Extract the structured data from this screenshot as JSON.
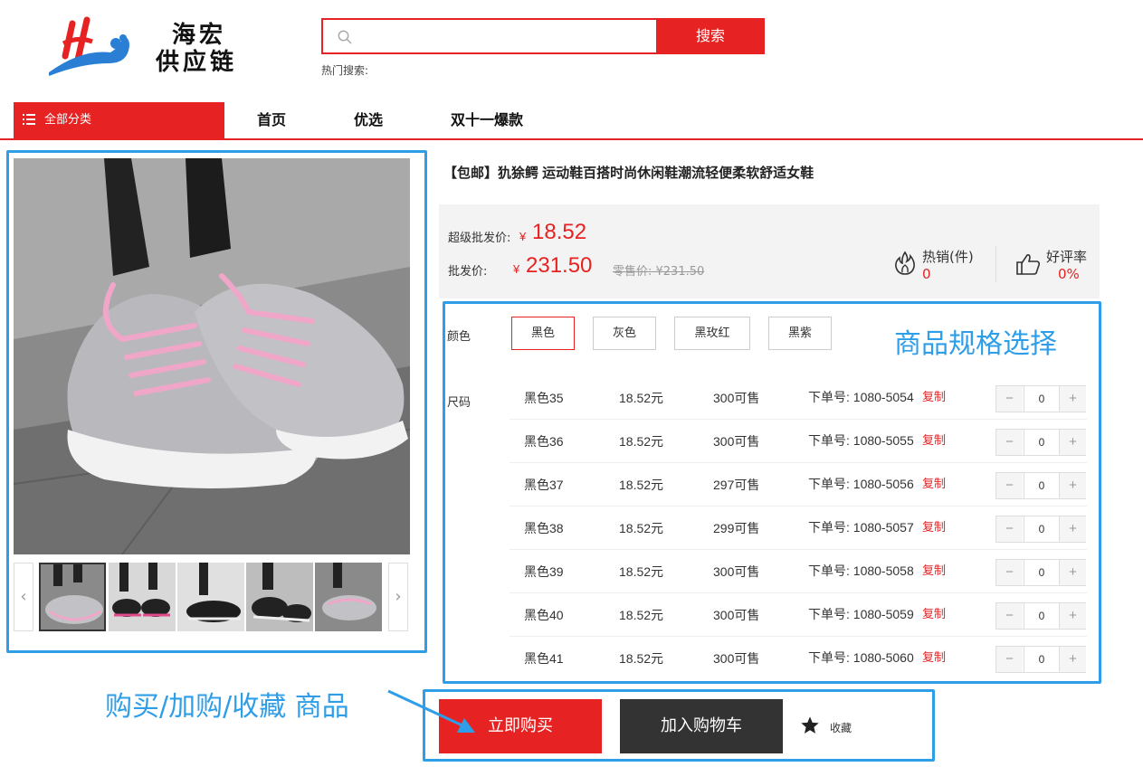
{
  "header": {
    "logo_line1": "海宏",
    "logo_line2": "供应链",
    "search_placeholder": "",
    "search_button": "搜索",
    "hot_search_label": "热门搜索:"
  },
  "nav": {
    "category_label": "全部分类",
    "items": [
      "首页",
      "优选",
      "双十一爆款"
    ]
  },
  "product": {
    "title": "【包邮】犰狳鳄 运动鞋百搭时尚休闲鞋潮流轻便柔软舒适女鞋",
    "super_wholesale_label": "超级批发价:",
    "super_wholesale_price": "18.52",
    "wholesale_label": "批发价:",
    "wholesale_price": "231.50",
    "currency": "¥",
    "retail_text": "零售价: ¥231.50",
    "hot_sales_label": "热销(件)",
    "hot_sales_value": "0",
    "rating_label": "好评率",
    "rating_value": "0%"
  },
  "spec": {
    "color_label": "颜色",
    "size_label": "尺码",
    "colors": [
      "黑色",
      "灰色",
      "黑玫红",
      "黑紫"
    ],
    "selected_color": "黑色",
    "section_annotation": "商品规格选择",
    "rows": [
      {
        "name": "黑色35",
        "price": "18.52元",
        "stock": "300可售",
        "order_no": "下单号: 1080-5054",
        "copy": "复制",
        "qty": "0"
      },
      {
        "name": "黑色36",
        "price": "18.52元",
        "stock": "300可售",
        "order_no": "下单号: 1080-5055",
        "copy": "复制",
        "qty": "0"
      },
      {
        "name": "黑色37",
        "price": "18.52元",
        "stock": "297可售",
        "order_no": "下单号: 1080-5056",
        "copy": "复制",
        "qty": "0"
      },
      {
        "name": "黑色38",
        "price": "18.52元",
        "stock": "299可售",
        "order_no": "下单号: 1080-5057",
        "copy": "复制",
        "qty": "0"
      },
      {
        "name": "黑色39",
        "price": "18.52元",
        "stock": "300可售",
        "order_no": "下单号: 1080-5058",
        "copy": "复制",
        "qty": "0"
      },
      {
        "name": "黑色40",
        "price": "18.52元",
        "stock": "300可售",
        "order_no": "下单号: 1080-5059",
        "copy": "复制",
        "qty": "0"
      },
      {
        "name": "黑色41",
        "price": "18.52元",
        "stock": "300可售",
        "order_no": "下单号: 1080-5060",
        "copy": "复制",
        "qty": "0"
      }
    ]
  },
  "actions": {
    "buy_now": "立即购买",
    "add_to_cart": "加入购物车",
    "favorite": "收藏",
    "annotation": "购买/加购/收藏  商品"
  },
  "gallery": {
    "thumbnail_count": 5,
    "active_thumbnail": 1
  },
  "colors": {
    "accent": "#e62222",
    "annotation": "#2e9ee8",
    "dark_button": "#333333"
  }
}
